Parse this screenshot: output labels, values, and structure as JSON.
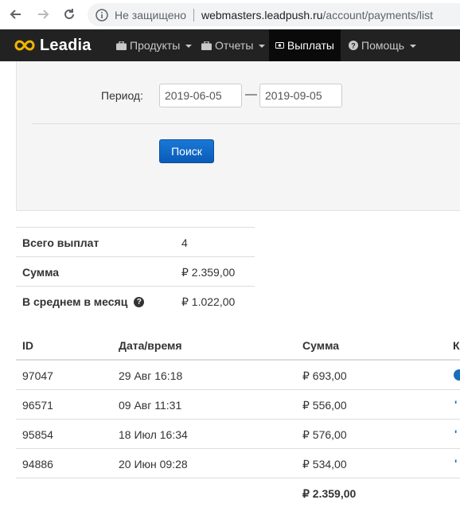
{
  "browser": {
    "security_text": "Не защищено",
    "url_host": "webmasters.leadpush.ru",
    "url_path": "/account/payments/list"
  },
  "navbar": {
    "brand": "Leadia",
    "brand_color": "#f0b400",
    "items": [
      {
        "label": "Продукты",
        "icon": "briefcase-icon"
      },
      {
        "label": "Отчеты",
        "icon": "briefcase-icon"
      },
      {
        "label": "Выплаты",
        "icon": "money-icon",
        "active": true
      },
      {
        "label": "Помощь",
        "icon": "question-circle-icon"
      }
    ]
  },
  "filter": {
    "period_label": "Период:",
    "date_from": "2019-06-05",
    "dash": "—",
    "date_to": "2019-09-05",
    "search_label": "Поиск",
    "button_color": "#0a5cb8"
  },
  "summary": {
    "rows": [
      {
        "label": "Всего выплат",
        "value": "4"
      },
      {
        "label": "Сумма",
        "value": "₽ 2.359,00"
      },
      {
        "label": "В среднем в месяц",
        "value": "₽ 1.022,00",
        "help_icon": "?"
      }
    ]
  },
  "payments": {
    "headers": {
      "id": "ID",
      "date": "Дата/время",
      "sum": "Сумма",
      "k": "К"
    },
    "rows": [
      {
        "id": "97047",
        "date": "29 Авг 16:18",
        "sum": "₽ 693,00"
      },
      {
        "id": "96571",
        "date": "09 Авг 11:31",
        "sum": "₽ 556,00"
      },
      {
        "id": "95854",
        "date": "18 Июл 16:34",
        "sum": "₽ 576,00"
      },
      {
        "id": "94886",
        "date": "20 Июн 09:28",
        "sum": "₽ 534,00"
      }
    ],
    "total": "₽ 2.359,00",
    "status_tick": "'"
  }
}
